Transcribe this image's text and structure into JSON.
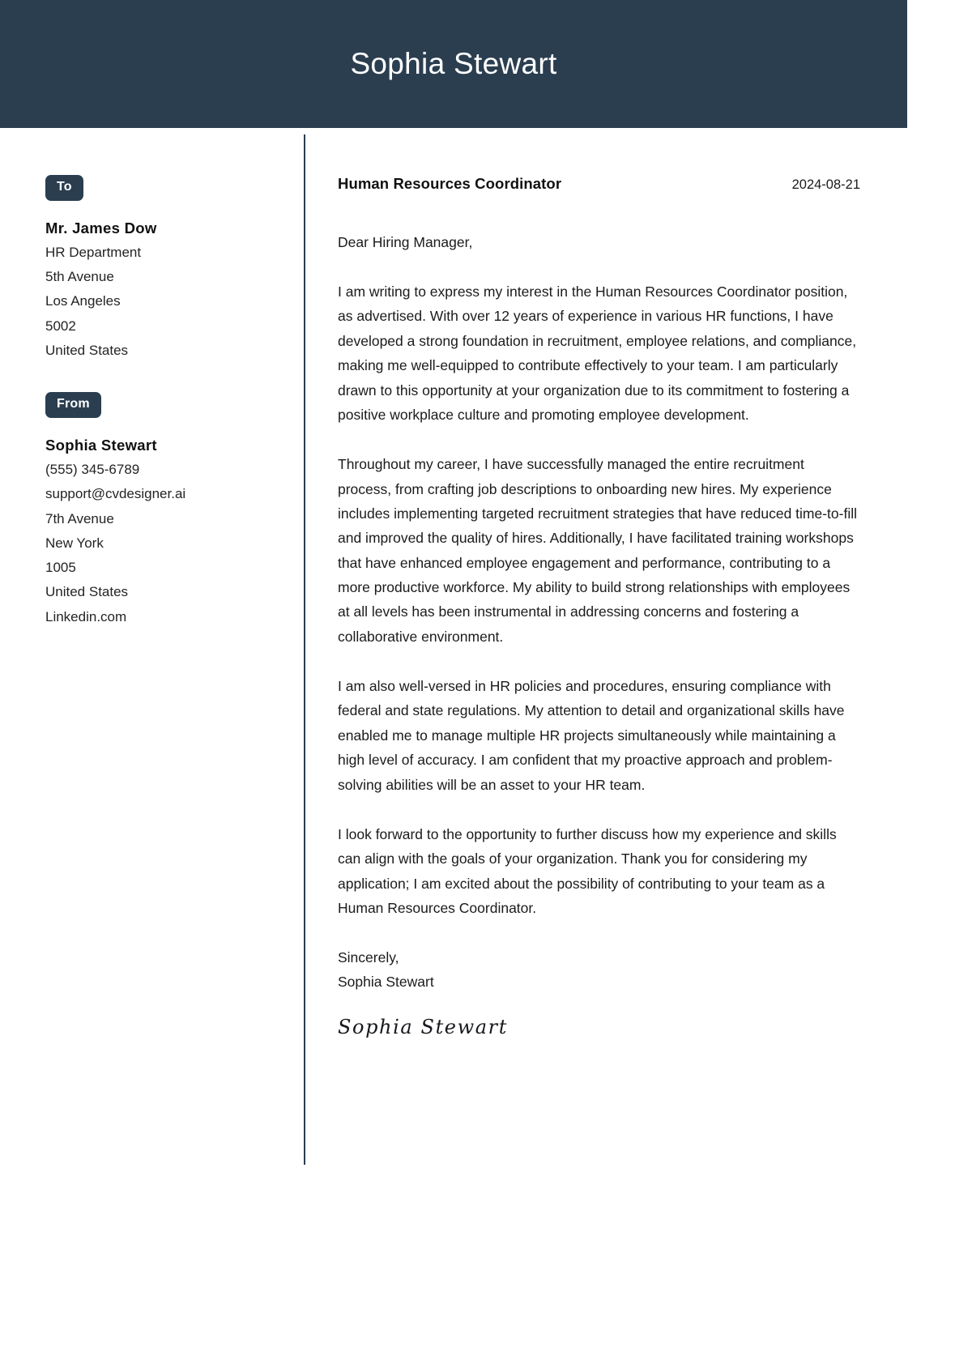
{
  "header": {
    "full_name": "Sophia Stewart",
    "background_color": "#2b3e50",
    "text_color": "#ffffff"
  },
  "sidebar": {
    "to": {
      "badge_label": "To",
      "name": "Mr. James Dow",
      "lines": [
        "HR Department",
        "5th Avenue",
        "Los Angeles",
        "5002",
        "United States"
      ]
    },
    "from": {
      "badge_label": "From",
      "name": "Sophia Stewart",
      "lines": [
        "(555) 345-6789",
        "support@cvdesigner.ai",
        "7th Avenue",
        "New York",
        "1005",
        "United States",
        "Linkedin.com"
      ]
    }
  },
  "letter": {
    "job_title": "Human Resources Coordinator",
    "date": "2024-08-21",
    "salutation": "Dear Hiring Manager,",
    "paragraphs": [
      "I am writing to express my interest in the Human Resources Coordinator position, as advertised. With over 12 years of experience in various HR functions, I have developed a strong foundation in recruitment, employee relations, and compliance, making me well-equipped to contribute effectively to your team. I am particularly drawn to this opportunity at your organization due to its commitment to fostering a positive workplace culture and promoting employee development.",
      "Throughout my career, I have successfully managed the entire recruitment process, from crafting job descriptions to onboarding new hires. My experience includes implementing targeted recruitment strategies that have reduced time-to-fill and improved the quality of hires. Additionally, I have facilitated training workshops that have enhanced employee engagement and performance, contributing to a more productive workforce. My ability to build strong relationships with employees at all levels has been instrumental in addressing concerns and fostering a collaborative environment.",
      "I am also well-versed in HR policies and procedures, ensuring compliance with federal and state regulations. My attention to detail and organizational skills have enabled me to manage multiple HR projects simultaneously while maintaining a high level of accuracy. I am confident that my proactive approach and problem-solving abilities will be an asset to your HR team.",
      "I look forward to the opportunity to further discuss how my experience and skills can align with the goals of your organization. Thank you for considering my application; I am excited about the possibility of contributing to your team as a Human Resources Coordinator."
    ],
    "closing": "Sincerely,",
    "closing_name": "Sophia Stewart",
    "signature": "Sophia Stewart"
  }
}
